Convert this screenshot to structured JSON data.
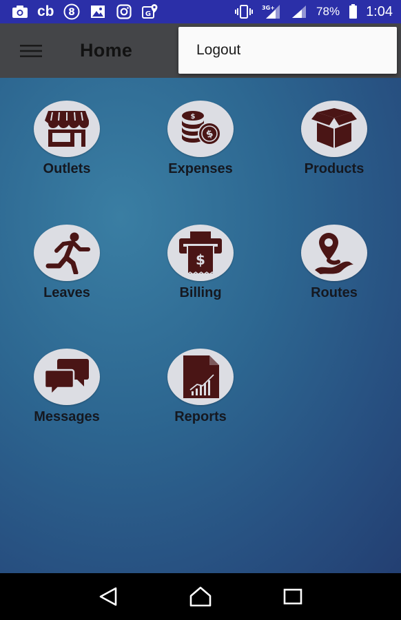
{
  "status_bar": {
    "network": "3G+",
    "battery_percent": "78%",
    "time": "1:04",
    "cb_label": "cb",
    "notification_icons": [
      "camera-icon",
      "cb-icon",
      "badge-8-icon",
      "image-icon",
      "instagram-icon",
      "maps-icon"
    ],
    "system_icons": [
      "vibrate-icon",
      "signal-icon",
      "signal-icon",
      "battery-icon"
    ]
  },
  "app_bar": {
    "title": "Home",
    "menu_icon": "hamburger-icon"
  },
  "overflow_menu": {
    "items": [
      {
        "label": "Logout"
      }
    ]
  },
  "tiles": [
    {
      "label": "Outlets",
      "icon": "store-icon"
    },
    {
      "label": "Expenses",
      "icon": "coins-icon"
    },
    {
      "label": "Products",
      "icon": "box-icon"
    },
    {
      "label": "Leaves",
      "icon": "running-person-icon"
    },
    {
      "label": "Billing",
      "icon": "receipt-printer-icon"
    },
    {
      "label": "Routes",
      "icon": "route-pin-icon"
    },
    {
      "label": "Messages",
      "icon": "chat-bubbles-icon"
    },
    {
      "label": "Reports",
      "icon": "report-chart-icon"
    }
  ],
  "colors": {
    "status_bar": "#2b2fa8",
    "app_bar": "#444548",
    "icon_fill": "#4a1515",
    "tile_circle": "#dcdde3",
    "background_top": "#3a7ea3",
    "background_bottom": "#233f72"
  },
  "nav_bar": {
    "buttons": [
      "back-icon",
      "home-icon",
      "recents-icon"
    ]
  }
}
